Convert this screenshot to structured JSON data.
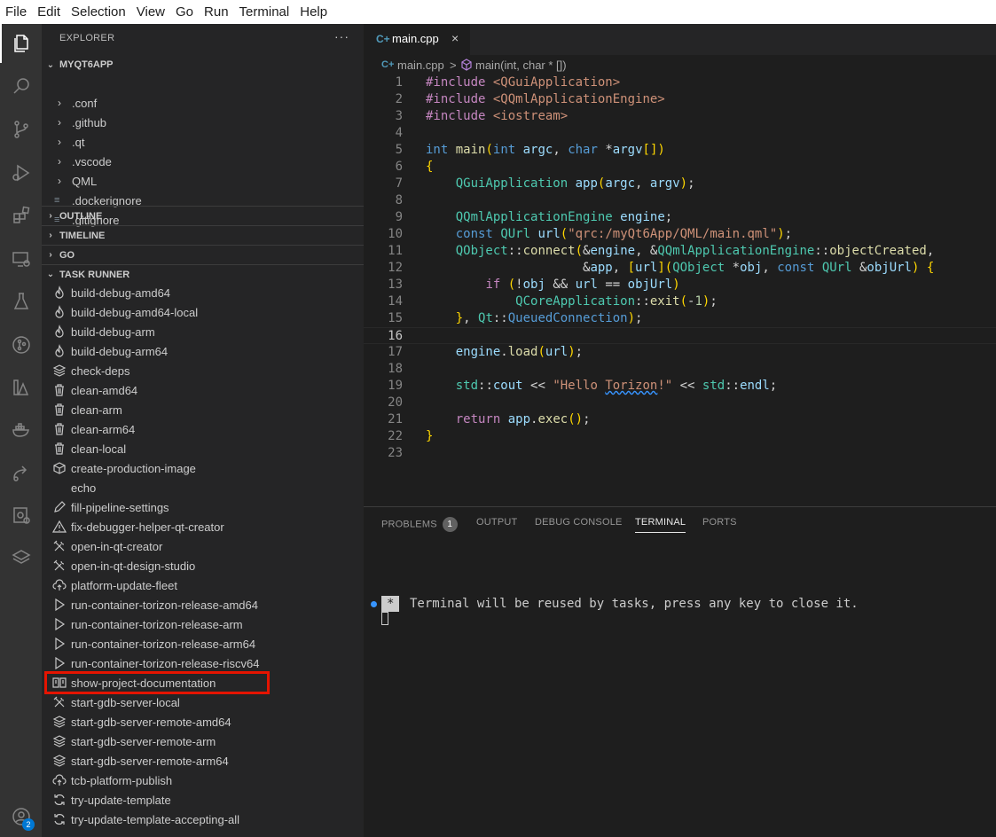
{
  "menu": [
    "File",
    "Edit",
    "Selection",
    "View",
    "Go",
    "Run",
    "Terminal",
    "Help"
  ],
  "activity_icons": [
    "explorer-icon",
    "search-icon",
    "source-control-icon",
    "run-debug-icon",
    "extensions-icon",
    "remote-explorer-icon",
    "testing-icon",
    "git-graph-icon",
    "linux-icon",
    "docker-icon",
    "deploy-icon",
    "torizon-icon",
    "layers-icon"
  ],
  "accounts_badge": "2",
  "explorer": {
    "title": "EXPLORER",
    "more": "···",
    "project": "MYQT6APP",
    "tree": [
      ".conf",
      ".github",
      ".qt",
      ".vscode",
      "QML",
      ".dockerignore",
      ".gitignore"
    ],
    "sections": [
      "OUTLINE",
      "TIMELINE",
      "GO",
      "TASK RUNNER"
    ]
  },
  "tasks": [
    {
      "label": "build-debug-amd64",
      "icon": "flame"
    },
    {
      "label": "build-debug-amd64-local",
      "icon": "flame"
    },
    {
      "label": "build-debug-arm",
      "icon": "flame"
    },
    {
      "label": "build-debug-arm64",
      "icon": "flame"
    },
    {
      "label": "check-deps",
      "icon": "layers"
    },
    {
      "label": "clean-amd64",
      "icon": "trash"
    },
    {
      "label": "clean-arm",
      "icon": "trash"
    },
    {
      "label": "clean-arm64",
      "icon": "trash"
    },
    {
      "label": "clean-local",
      "icon": "trash"
    },
    {
      "label": "create-production-image",
      "icon": "package"
    },
    {
      "label": "echo",
      "icon": "none"
    },
    {
      "label": "fill-pipeline-settings",
      "icon": "pencil"
    },
    {
      "label": "fix-debugger-helper-qt-creator",
      "icon": "warning"
    },
    {
      "label": "open-in-qt-creator",
      "icon": "tools"
    },
    {
      "label": "open-in-qt-design-studio",
      "icon": "tools"
    },
    {
      "label": "platform-update-fleet",
      "icon": "cloud-upload"
    },
    {
      "label": "run-container-torizon-release-amd64",
      "icon": "play"
    },
    {
      "label": "run-container-torizon-release-arm",
      "icon": "play"
    },
    {
      "label": "run-container-torizon-release-arm64",
      "icon": "play"
    },
    {
      "label": "run-container-torizon-release-riscv64",
      "icon": "play"
    },
    {
      "label": "show-project-documentation",
      "icon": "book"
    },
    {
      "label": "start-gdb-server-local",
      "icon": "tools"
    },
    {
      "label": "start-gdb-server-remote-amd64",
      "icon": "layers"
    },
    {
      "label": "start-gdb-server-remote-arm",
      "icon": "layers"
    },
    {
      "label": "start-gdb-server-remote-arm64",
      "icon": "layers"
    },
    {
      "label": "tcb-platform-publish",
      "icon": "cloud-upload"
    },
    {
      "label": "try-update-template",
      "icon": "sync"
    },
    {
      "label": "try-update-template-accepting-all",
      "icon": "sync"
    }
  ],
  "editor": {
    "tab_icon": "C+",
    "tab_name": "main.cpp",
    "tab_close": "×",
    "breadcrumb_file": "main.cpp",
    "breadcrumb_sep": ">",
    "breadcrumb_symbol": "main(int, char * [])",
    "current_line": 16,
    "lines": [
      "#include <QGuiApplication>",
      "#include <QQmlApplicationEngine>",
      "#include <iostream>",
      "",
      "int main(int argc, char *argv[])",
      "{",
      "    QGuiApplication app(argc, argv);",
      "",
      "    QQmlApplicationEngine engine;",
      "    const QUrl url(\"qrc:/myQt6App/QML/main.qml\");",
      "    QObject::connect(&engine, &QQmlApplicationEngine::objectCreated,",
      "                     &app, [url](QObject *obj, const QUrl &objUrl) {",
      "        if (!obj && url == objUrl)",
      "            QCoreApplication::exit(-1);",
      "    }, Qt::QueuedConnection);",
      "",
      "    engine.load(url);",
      "",
      "    std::cout << \"Hello Torizon!\" << std::endl;",
      "",
      "    return app.exec();",
      "}",
      ""
    ]
  },
  "panel": {
    "tabs": [
      "PROBLEMS",
      "OUTPUT",
      "DEBUG CONSOLE",
      "TERMINAL",
      "PORTS"
    ],
    "active_tab": "TERMINAL",
    "problems_count": "1",
    "terminal_star": "*",
    "terminal_message": "Terminal will be reused by tasks, press any key to close it."
  },
  "colors": {
    "highlight": "#e51400",
    "accent": "#0078d4"
  }
}
